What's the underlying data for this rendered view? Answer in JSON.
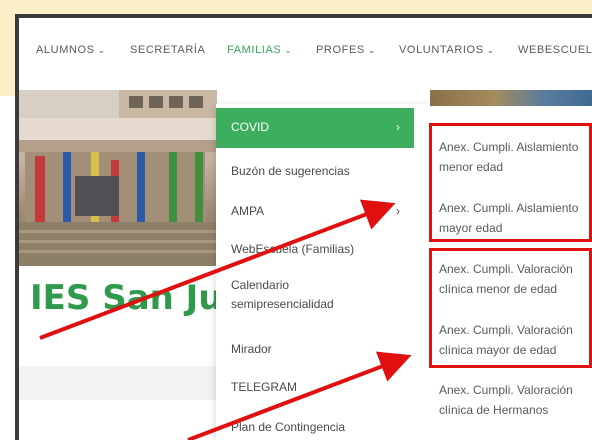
{
  "nav": {
    "items": [
      {
        "label": "ALUMNOS",
        "chevron": "⌄"
      },
      {
        "label": "SECRETARÍA",
        "chevron": ""
      },
      {
        "label": "FAMILIAS",
        "chevron": "⌄"
      },
      {
        "label": "PROFES",
        "chevron": "⌄"
      },
      {
        "label": "VOLUNTARIOS",
        "chevron": "⌄"
      },
      {
        "label": "WEBESCUELA",
        "chevron": ""
      }
    ],
    "active_color": "#36a55a"
  },
  "site": {
    "title": "IES San Jua"
  },
  "dropdown": {
    "items": [
      {
        "label": "COVID"
      },
      {
        "label": "Buzón de sugerencias"
      },
      {
        "label": "AMPA"
      },
      {
        "label": "WebEscuela (Familias)"
      },
      {
        "label": "Calendario semipresencialidad"
      },
      {
        "label": "Mirador"
      },
      {
        "label": "TELEGRAM"
      },
      {
        "label": "Plan de Contingencia"
      }
    ],
    "chevron": "›",
    "active_color": "#3cae5d"
  },
  "submenu": {
    "items": [
      {
        "label": "Anex. Cumpli. Aislamiento menor edad"
      },
      {
        "label": "Anex. Cumpli. Aislamiento mayor edad"
      },
      {
        "label": "Anex. Cumpli. Valoración clínica menor de edad"
      },
      {
        "label": "Anex. Cumpli. Valoración clínica mayor de edad"
      },
      {
        "label": "Anex. Cumpli. Valoración clínica de Hermanos"
      }
    ]
  },
  "annotations": {
    "highlight_color": "#e01010"
  }
}
